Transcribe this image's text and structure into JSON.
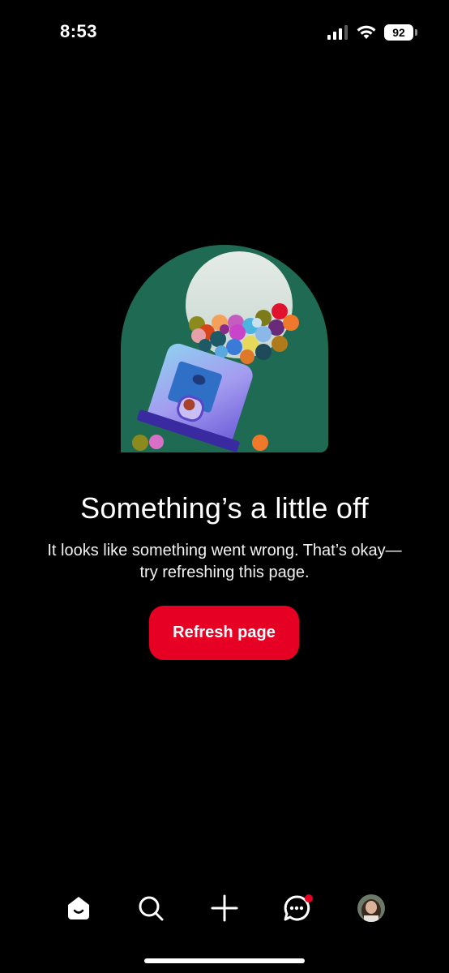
{
  "status_bar": {
    "time": "8:53",
    "battery": "92"
  },
  "error": {
    "title": "Something’s a little off",
    "message": "It looks like something went wrong. That’s okay—try refreshing this page.",
    "button_label": "Refresh page"
  },
  "colors": {
    "background": "#000000",
    "accent": "#e60023",
    "illustration_bg": "#1f6a52"
  },
  "bottom_nav": {
    "items": [
      {
        "name": "home",
        "icon": "home-icon",
        "active": true
      },
      {
        "name": "search",
        "icon": "search-icon",
        "active": false
      },
      {
        "name": "create",
        "icon": "plus-icon",
        "active": false
      },
      {
        "name": "messages",
        "icon": "chat-icon",
        "active": false,
        "has_notification": true
      },
      {
        "name": "profile",
        "icon": "avatar",
        "active": false
      }
    ]
  }
}
